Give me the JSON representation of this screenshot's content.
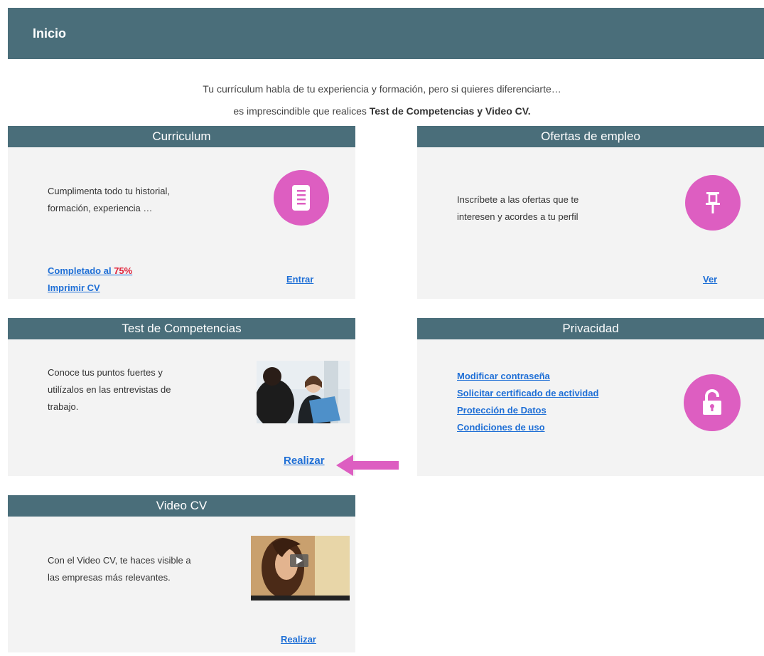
{
  "header": {
    "title": "Inicio"
  },
  "intro": {
    "line1": "Tu currículum habla de tu experiencia y formación, pero si quieres diferenciarte…",
    "line2_prefix": "es imprescindible que realices ",
    "line2_bold": "Test de Competencias y Video CV."
  },
  "cards": {
    "curriculum": {
      "title": "Curriculum",
      "text_line1": "Cumplimenta todo tu historial,",
      "text_line2": "formación, experiencia …",
      "completed_label": "Completado al ",
      "completed_pct": "75%",
      "print_label": "Imprimir CV",
      "enter_label": "Entrar",
      "icon": "document-icon"
    },
    "ofertas": {
      "title": "Ofertas de empleo",
      "text_line1": "Inscríbete a las ofertas que te",
      "text_line2": "interesen y acordes a tu perfil",
      "action_label": "Ver",
      "icon": "pushpin-icon"
    },
    "test": {
      "title": "Test de Competencias",
      "text_line1": "Conoce tus puntos fuertes y",
      "text_line2": "utilízalos en las entrevistas de",
      "text_line3": "trabajo.",
      "action_label": "Realizar"
    },
    "privacidad": {
      "title": "Privacidad",
      "links": [
        "Modificar contraseña",
        "Solicitar certificado de actividad",
        "Protección de Datos",
        "Condiciones de uso"
      ],
      "icon": "padlock-icon"
    },
    "video": {
      "title": "Video CV",
      "text_line1": "Con el Video CV, te haces visible a",
      "text_line2": "las empresas más relevantes.",
      "action_label": "Realizar"
    }
  },
  "colors": {
    "header_bg": "#4a6e7a",
    "card_bg": "#f3f3f3",
    "accent_pink": "#dd5ec1",
    "link_blue": "#1f6fd6",
    "percent_red": "#e0233a"
  }
}
